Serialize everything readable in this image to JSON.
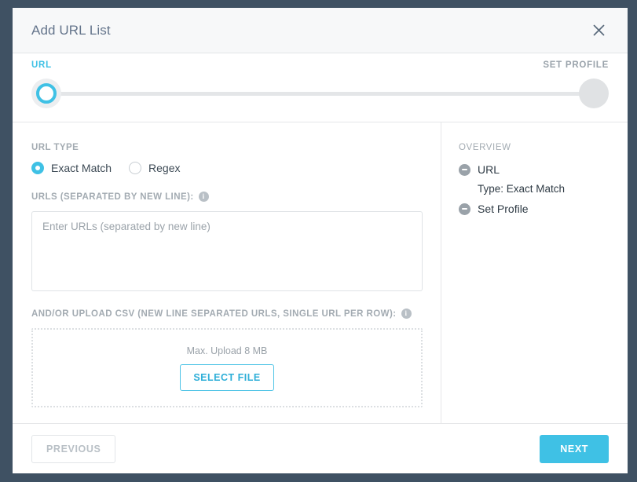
{
  "dialog": {
    "title": "Add URL List",
    "close_icon": "close-icon"
  },
  "stepper": {
    "steps": [
      {
        "label": "URL",
        "state": "active"
      },
      {
        "label": "SET PROFILE",
        "state": "inactive"
      }
    ]
  },
  "form": {
    "url_type": {
      "label": "URL TYPE",
      "options": [
        {
          "label": "Exact Match",
          "selected": true
        },
        {
          "label": "Regex",
          "selected": false
        }
      ]
    },
    "urls_field": {
      "label": "URLS (SEPARATED BY NEW LINE):",
      "info_icon": "info-icon",
      "placeholder": "Enter URLs (separated by new line)",
      "value": ""
    },
    "csv_field": {
      "label": "AND/OR UPLOAD CSV (NEW LINE SEPARATED URLS, SINGLE URL PER ROW):",
      "info_icon": "info-icon",
      "max_upload_text": "Max. Upload 8 MB",
      "select_file_label": "SELECT FILE"
    }
  },
  "overview": {
    "title": "OVERVIEW",
    "items": [
      {
        "name": "URL",
        "detail": "Type: Exact Match"
      },
      {
        "name": "Set Profile",
        "detail": null
      }
    ]
  },
  "footer": {
    "previous_label": "PREVIOUS",
    "next_label": "NEXT"
  },
  "colors": {
    "accent": "#3fc1e5",
    "frame": "#3f5163",
    "text_muted": "#a3abb2",
    "text_dark": "#2f3b45"
  }
}
